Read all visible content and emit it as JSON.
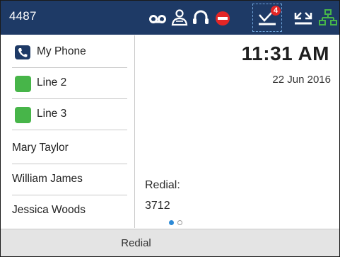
{
  "status_bar": {
    "extension": "4487",
    "icons": [
      "voicemail-icon",
      "contacts-icon",
      "headset-icon",
      "do-not-disturb-icon",
      "messages-icon",
      "missed-calls-icon",
      "network-icon"
    ],
    "message_count": "4",
    "colors": {
      "background": "#1e3a66",
      "dnd": "#e32626",
      "network": "#47b549",
      "focus_outline": "#6ea2d8"
    }
  },
  "lines": [
    {
      "label": "My Phone",
      "icon": "phone-icon"
    },
    {
      "label": "Line 2",
      "icon": "line-status-icon"
    },
    {
      "label": "Line 3",
      "icon": "line-status-icon"
    }
  ],
  "contacts": [
    {
      "label": "Mary Taylor"
    },
    {
      "label": "William James"
    },
    {
      "label": "Jessica Woods"
    }
  ],
  "clock": {
    "time": "11:31 AM",
    "date": "22 Jun 2016"
  },
  "redial": {
    "title": "Redial:",
    "number": "3712"
  },
  "pager": {
    "pages": 2,
    "current": 1
  },
  "softkeys": [
    {
      "label": "Redial"
    }
  ],
  "colors": {
    "line_active": "#47b549",
    "pager_active": "#2d8ad6"
  }
}
